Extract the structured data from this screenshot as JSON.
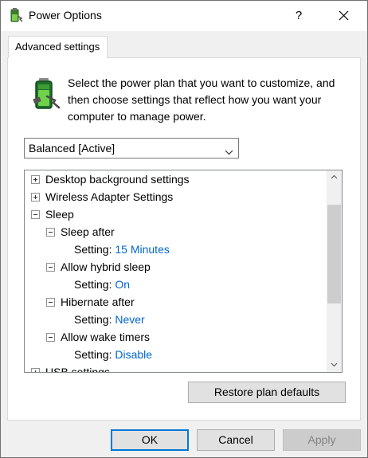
{
  "window": {
    "title": "Power Options",
    "help_symbol": "?"
  },
  "tab": {
    "label": "Advanced settings"
  },
  "description": "Select the power plan that you want to customize, and then choose settings that reflect how you want your computer to manage power.",
  "plan_select": {
    "value": "Balanced [Active]"
  },
  "tree": {
    "desktop_background": "Desktop background settings",
    "wireless_adapter": "Wireless Adapter Settings",
    "sleep": "Sleep",
    "sleep_after": "Sleep after",
    "sleep_after_setting_label": "Setting:",
    "sleep_after_value": "15 Minutes",
    "allow_hybrid_sleep": "Allow hybrid sleep",
    "allow_hybrid_sleep_setting_label": "Setting:",
    "allow_hybrid_sleep_value": "On",
    "hibernate_after": "Hibernate after",
    "hibernate_after_setting_label": "Setting:",
    "hibernate_after_value": "Never",
    "allow_wake_timers": "Allow wake timers",
    "allow_wake_timers_setting_label": "Setting:",
    "allow_wake_timers_value": "Disable",
    "usb_settings": "USB settings"
  },
  "buttons": {
    "restore_defaults": "Restore plan defaults",
    "ok": "OK",
    "cancel": "Cancel",
    "apply": "Apply"
  },
  "colors": {
    "setting_value": "#0066cc",
    "focus_border": "#0078d7"
  },
  "icons": {
    "title": "power-options-icon",
    "battery": "battery-plug-icon",
    "close": "close-icon",
    "dropdown": "chevron-down-icon"
  }
}
